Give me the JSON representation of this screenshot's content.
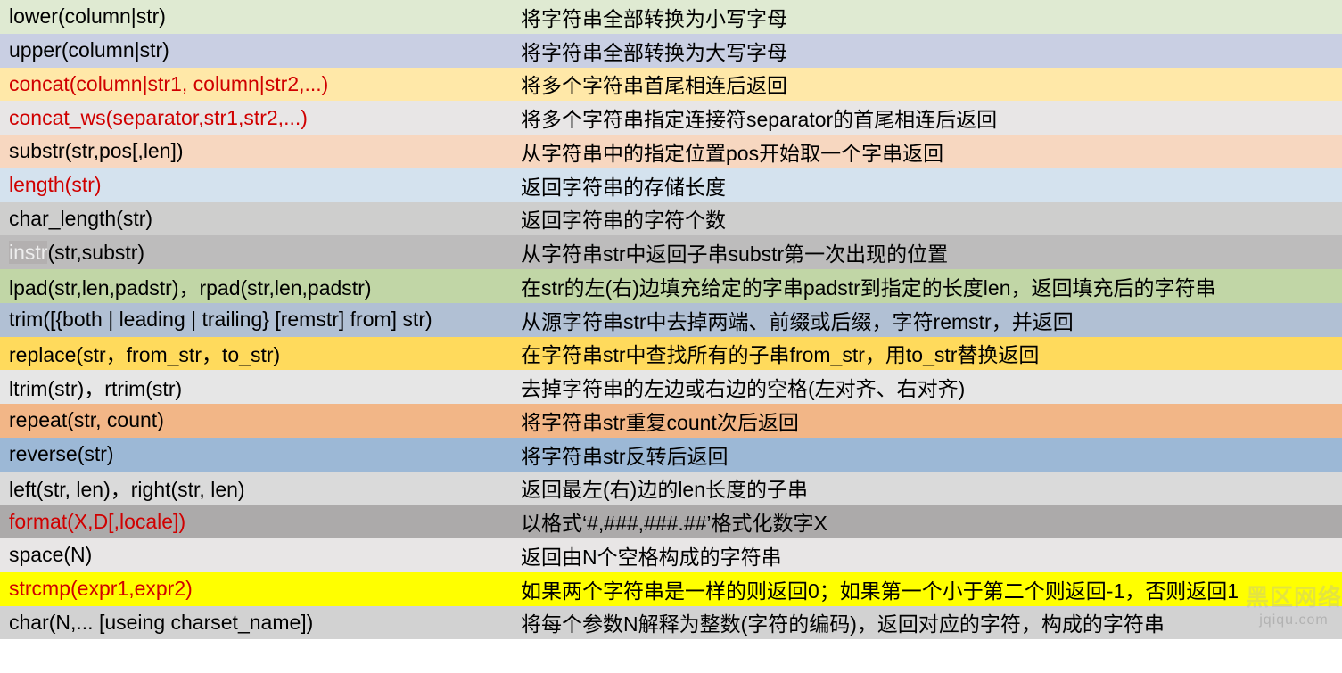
{
  "rows": [
    {
      "func": "lower(column|str)",
      "desc": "将字符串全部转换为小写字母",
      "bg": "bg-lightgreen",
      "funcColor": "black"
    },
    {
      "func": "upper(column|str)",
      "desc": "将字符串全部转换为大写字母",
      "bg": "bg-lightblue1",
      "funcColor": "black"
    },
    {
      "func": "concat(column|str1, column|str2,...)",
      "desc": "将多个字符串首尾相连后返回",
      "bg": "bg-lightyellow",
      "funcColor": "red"
    },
    {
      "func": "concat_ws(separator,str1,str2,...)",
      "desc": "将多个字符串指定连接符separator的首尾相连后返回",
      "bg": "bg-lightgray1",
      "funcColor": "red"
    },
    {
      "func": "substr(str,pos[,len])",
      "desc": "从字符串中的指定位置pos开始取一个字串返回",
      "bg": "bg-lightorange",
      "funcColor": "black"
    },
    {
      "func": "length(str)",
      "desc": "返回字符串的存储长度",
      "bg": "bg-lightblue2",
      "funcColor": "red"
    },
    {
      "func": "char_length(str)",
      "desc": "返回字符串的字符个数",
      "bg": "bg-midgray",
      "funcColor": "black"
    },
    {
      "func_prefix": "instr",
      "func_suffix": "(str,substr)",
      "desc": "从字符串str中返回子串substr第一次出现的位置",
      "bg": "bg-gray2",
      "funcColor": "black",
      "instrHighlight": true
    },
    {
      "func": "lpad(str,len,padstr)，rpad(str,len,padstr)",
      "desc": "在str的左(右)边填充给定的字串padstr到指定的长度len，返回填充后的字符串",
      "bg": "bg-green2",
      "funcColor": "black"
    },
    {
      "func": "trim([{both | leading | trailing} [remstr] from] str)",
      "desc": "从源字符串str中去掉两端、前缀或后缀，字符remstr，并返回",
      "bg": "bg-bluegray",
      "funcColor": "black"
    },
    {
      "func": "replace(str，from_str，to_str)",
      "desc": "在字符串str中查找所有的子串from_str，用to_str替换返回",
      "bg": "bg-yellow2",
      "funcColor": "black"
    },
    {
      "func": "ltrim(str)，rtrim(str)",
      "desc": "去掉字符串的左边或右边的空格(左对齐、右对齐)",
      "bg": "bg-gray3",
      "funcColor": "black"
    },
    {
      "func": "repeat(str, count)",
      "desc": "将字符串str重复count次后返回",
      "bg": "bg-orange2",
      "funcColor": "black"
    },
    {
      "func": "reverse(str)",
      "desc": "将字符串str反转后返回",
      "bg": "bg-blue3",
      "funcColor": "black"
    },
    {
      "func": "left(str, len)，right(str, len)",
      "desc": "返回最左(右)边的len长度的子串",
      "bg": "bg-gray4",
      "funcColor": "black"
    },
    {
      "func": "format(X,D[,locale])",
      "desc": "以格式‘#,###,###.##’格式化数字X",
      "bg": "bg-darkgray",
      "funcColor": "red"
    },
    {
      "func": "space(N)",
      "desc": "返回由N个空格构成的字符串",
      "bg": "bg-lightgray1",
      "funcColor": "black"
    },
    {
      "func": "strcmp(expr1,expr2)",
      "desc": "如果两个字符串是一样的则返回0；如果第一个小于第二个则返回-1，否则返回1",
      "bg": "bg-brightyellow",
      "funcColor": "red"
    },
    {
      "func": "char(N,... [useing  charset_name])",
      "desc": "将每个参数N解释为整数(字符的编码)，返回对应的字符，构成的字符串",
      "bg": "bg-gray5",
      "funcColor": "black"
    }
  ],
  "watermark": {
    "main": "黑区网络",
    "sub": "jqiqu.com"
  }
}
